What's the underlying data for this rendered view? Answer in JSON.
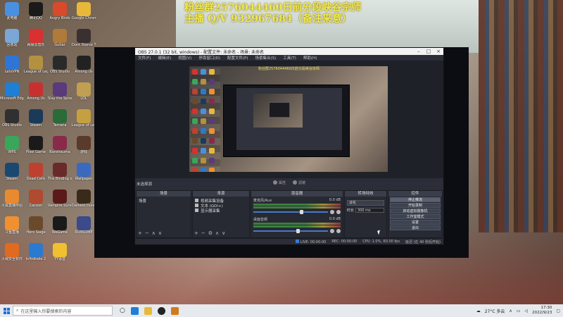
{
  "overlay": {
    "line1": "粉丝群2576044460日前分段峡谷宗师",
    "line2": "主播 Q/V 932967684（备注来意）"
  },
  "desktop_icons": [
    {
      "label": "此电脑",
      "color": "#4a90e2",
      "glyph": "computer-icon"
    },
    {
      "label": "腾讯QQ",
      "color": "#1a1a1a",
      "glyph": "qq-icon"
    },
    {
      "label": "Angry Birds",
      "color": "#d94a2b",
      "glyph": "game-icon"
    },
    {
      "label": "Google Chrome",
      "color": "#e8b83a",
      "glyph": "chrome-icon"
    },
    {
      "label": "回收站",
      "color": "#7aa7d6",
      "glyph": "recycle-bin-icon"
    },
    {
      "label": "网易云音乐",
      "color": "#d8312f",
      "glyph": "music-icon"
    },
    {
      "label": "Guitar",
      "color": "#b07a3a",
      "glyph": "app-icon"
    },
    {
      "label": "Dont Starve Together",
      "color": "#3a3030",
      "glyph": "game-icon"
    },
    {
      "label": "LetsVPN",
      "color": "#2f75d6",
      "glyph": "vpn-icon"
    },
    {
      "label": "League of Legends",
      "color": "#b39140",
      "glyph": "lol-icon"
    },
    {
      "label": "OBS Studio",
      "color": "#2a2a2a",
      "glyph": "game-icon"
    },
    {
      "label": "Among Us",
      "color": "#222",
      "glyph": "game-icon"
    },
    {
      "label": "Microsoft Edge",
      "color": "#1e7fd6",
      "glyph": "edge-icon"
    },
    {
      "label": "Among Us",
      "color": "#c83030",
      "glyph": "game-icon"
    },
    {
      "label": "Slay the Spire",
      "color": "#5a3a7a",
      "glyph": "game-icon"
    },
    {
      "label": "LOL",
      "color": "#c0a050",
      "glyph": "lol-icon"
    },
    {
      "label": "OBS Studio",
      "color": "#303030",
      "glyph": "obs-icon"
    },
    {
      "label": "Steam",
      "color": "#1b3a5a",
      "glyph": "steam-icon"
    },
    {
      "label": "Terraria",
      "color": "#2a6b3a",
      "glyph": "game-icon"
    },
    {
      "label": "League of Legends",
      "color": "#c5a040",
      "glyph": "lol-icon"
    },
    {
      "label": "WPS",
      "color": "#3aa65a",
      "glyph": "app-icon"
    },
    {
      "label": "Pixel Game",
      "color": "#1a1a1a",
      "glyph": "game-icon"
    },
    {
      "label": "Barotrauma",
      "color": "#8a2a4a",
      "glyph": "game-icon"
    },
    {
      "label": "游戏",
      "color": "#5a3a2a",
      "glyph": "game-icon"
    },
    {
      "label": "Steam",
      "color": "#1b4870",
      "glyph": "steam-icon"
    },
    {
      "label": "Dead Cells",
      "color": "#c04030",
      "glyph": "game-icon"
    },
    {
      "label": "The Binding of Isaac",
      "color": "#6a2a2a",
      "glyph": "game-icon"
    },
    {
      "label": "Wallpaper",
      "color": "#3a6ac0",
      "glyph": "app-icon"
    },
    {
      "label": "火狐直播伴侣",
      "color": "#e88a30",
      "glyph": "app-icon"
    },
    {
      "label": "Cacoon",
      "color": "#b04a30",
      "glyph": "game-icon"
    },
    {
      "label": "Vampire Survivors",
      "color": "#5a1a1a",
      "glyph": "game-icon"
    },
    {
      "label": "Darkest Dungeon",
      "color": "#3a2a1a",
      "glyph": "game-icon"
    },
    {
      "label": "斗鱼直播",
      "color": "#f09030",
      "glyph": "app-icon"
    },
    {
      "label": "Hero Siege",
      "color": "#6a4a2a",
      "glyph": "game-icon"
    },
    {
      "label": "WeGame",
      "color": "#1a1a1a",
      "glyph": "app-icon"
    },
    {
      "label": "RUNSOME",
      "color": "#3a4a8a",
      "glyph": "game-icon"
    },
    {
      "label": "火绒安全软件",
      "color": "#e06a20",
      "glyph": "app-icon"
    },
    {
      "label": "Infinitode 2",
      "color": "#2a7ad0",
      "glyph": "game-icon"
    },
    {
      "label": "YY语音",
      "color": "#f0c030",
      "glyph": "app-icon"
    }
  ],
  "obs": {
    "title": "OBS 27.0.1 (32 bit, windows) - 配置文件: 未命名 - 场景: 未命名",
    "menu": [
      "文件(F)",
      "编辑(E)",
      "视图(V)",
      "停靠窗口(D)",
      "配置文件(P)",
      "场景集合(S)",
      "工具(T)",
      "帮助(H)"
    ],
    "preview_overlay_text": "粉丝群2576044460日前分段峡谷宗师",
    "no_source_label": "未选择源",
    "transport": {
      "settings": "属性",
      "filters": "滤镜"
    },
    "docks": {
      "scenes": {
        "title": "场景",
        "items": [
          "场景"
        ]
      },
      "sources": {
        "title": "来源",
        "items": [
          "视频采集设备",
          "文本 (GDI+)",
          "显示器采集"
        ]
      },
      "mixer": {
        "title": "混音器",
        "channels": [
          {
            "name": "麦克风/Aux",
            "db": "0.0 dB",
            "level": 0.62
          },
          {
            "name": "桌面音频",
            "db": "0.0 dB",
            "level": 0.58
          }
        ]
      },
      "transitions": {
        "title": "转场特效",
        "selected": "淡化",
        "duration_label": "时长",
        "duration_value": "300 ms"
      },
      "controls": {
        "title": "控件",
        "buttons": [
          "停止推流",
          "开始录制",
          "启动虚拟摄像机",
          "工作室模式",
          "设置",
          "退出"
        ]
      }
    },
    "status": {
      "live": "LIVE: 00:00:00",
      "rec": "REC: 00:00:00",
      "cpu": "CPU: 1.0%, 60.00 fps",
      "stats": "延迟 (在 40 秒后开始)"
    }
  },
  "taskbar": {
    "search_placeholder": "在这里输入你要搜索的内容",
    "weather": "27°C 多云",
    "time": "17:30",
    "date": "2022/9/23"
  }
}
